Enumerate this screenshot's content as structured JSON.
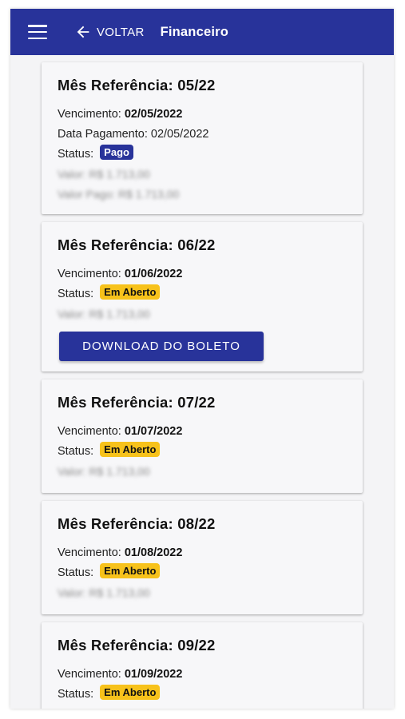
{
  "header": {
    "back_label": "VOLTAR",
    "title": "Financeiro",
    "bar_color": "#28339a"
  },
  "labels": {
    "vencimento": "Vencimento:",
    "data_pagamento": "Data Pagamento:",
    "status": "Status:"
  },
  "invoices": [
    {
      "title": "Mês Referência: 05/22",
      "vencimento": "02/05/2022",
      "data_pagamento": "02/05/2022",
      "status": "Pago",
      "valor": "Valor: R$ 1.713,00",
      "valor_pago": "Valor Pago: R$ 1.713,00"
    },
    {
      "title": "Mês Referência: 06/22",
      "vencimento": "01/06/2022",
      "status": "Em Aberto",
      "valor": "Valor: R$ 1.713,00",
      "download_label": "DOWNLOAD DO BOLETO"
    },
    {
      "title": "Mês Referência: 07/22",
      "vencimento": "01/07/2022",
      "status": "Em Aberto",
      "valor": "Valor: R$ 1.713,00"
    },
    {
      "title": "Mês Referência: 08/22",
      "vencimento": "01/08/2022",
      "status": "Em Aberto",
      "valor": "Valor: R$ 1.713,00"
    },
    {
      "title": "Mês Referência: 09/22",
      "vencimento": "01/09/2022",
      "status": "Em Aberto"
    }
  ],
  "colors": {
    "status_pago": "#28339a",
    "status_aberto": "#f7c21b"
  }
}
